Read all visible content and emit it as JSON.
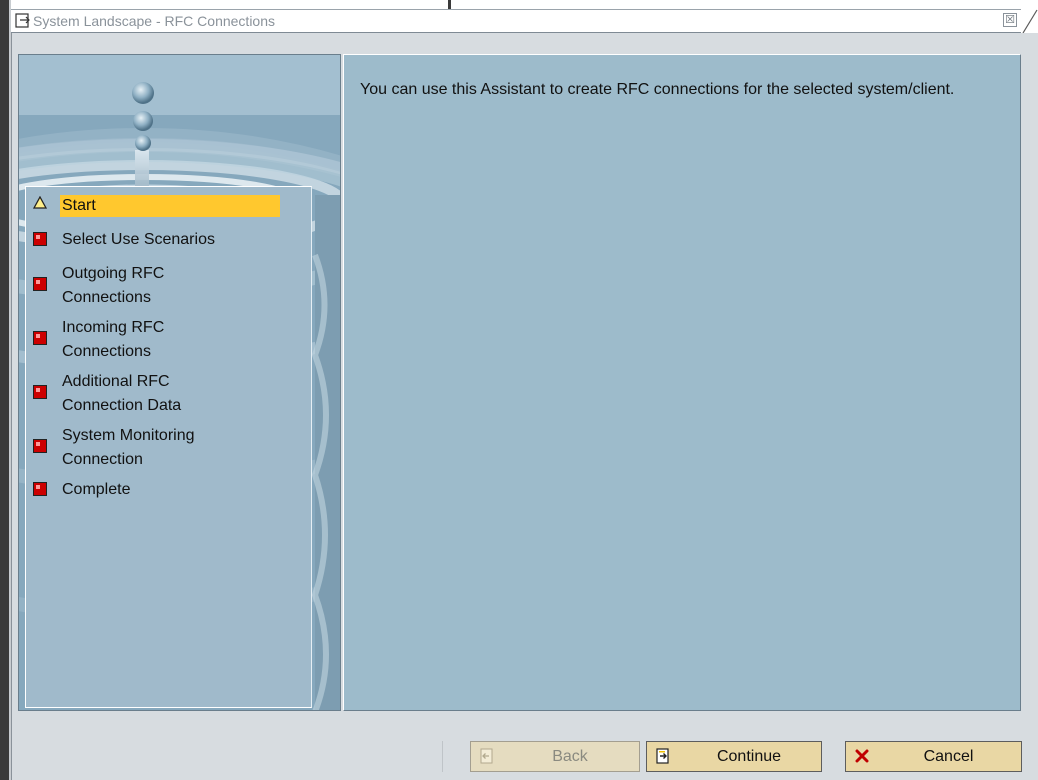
{
  "window": {
    "title": "System Landscape - RFC Connections",
    "close_glyph": "☒"
  },
  "steps": [
    {
      "label": "Start",
      "status": "current",
      "icon": "warning-triangle-icon"
    },
    {
      "label": "Select Use Scenarios",
      "status": "pending",
      "icon": "red-square-icon"
    },
    {
      "label": "Outgoing RFC",
      "label2": "Connections",
      "status": "pending",
      "icon": "red-square-icon"
    },
    {
      "label": "Incoming RFC",
      "label2": "Connections",
      "status": "pending",
      "icon": "red-square-icon"
    },
    {
      "label": "Additional RFC",
      "label2": "Connection Data",
      "status": "pending",
      "icon": "red-square-icon"
    },
    {
      "label": "System Monitoring",
      "label2": "Connection",
      "status": "pending",
      "icon": "red-square-icon"
    },
    {
      "label": "Complete",
      "status": "pending",
      "icon": "red-square-icon"
    }
  ],
  "content": {
    "text": "You can use this Assistant to create RFC connections for the selected system/client."
  },
  "buttons": {
    "back": {
      "label": "Back",
      "enabled": false,
      "icon": "back-arrow-icon"
    },
    "continue": {
      "label": "Continue",
      "enabled": true,
      "icon": "continue-arrow-icon"
    },
    "cancel": {
      "label": "Cancel",
      "enabled": true,
      "icon": "cancel-x-icon"
    }
  },
  "colors": {
    "active_step_highlight": "#ffc82e",
    "pending_icon": "#cc0000",
    "content_bg": "#9dbbcb",
    "button_bg": "#e9d7a4"
  }
}
